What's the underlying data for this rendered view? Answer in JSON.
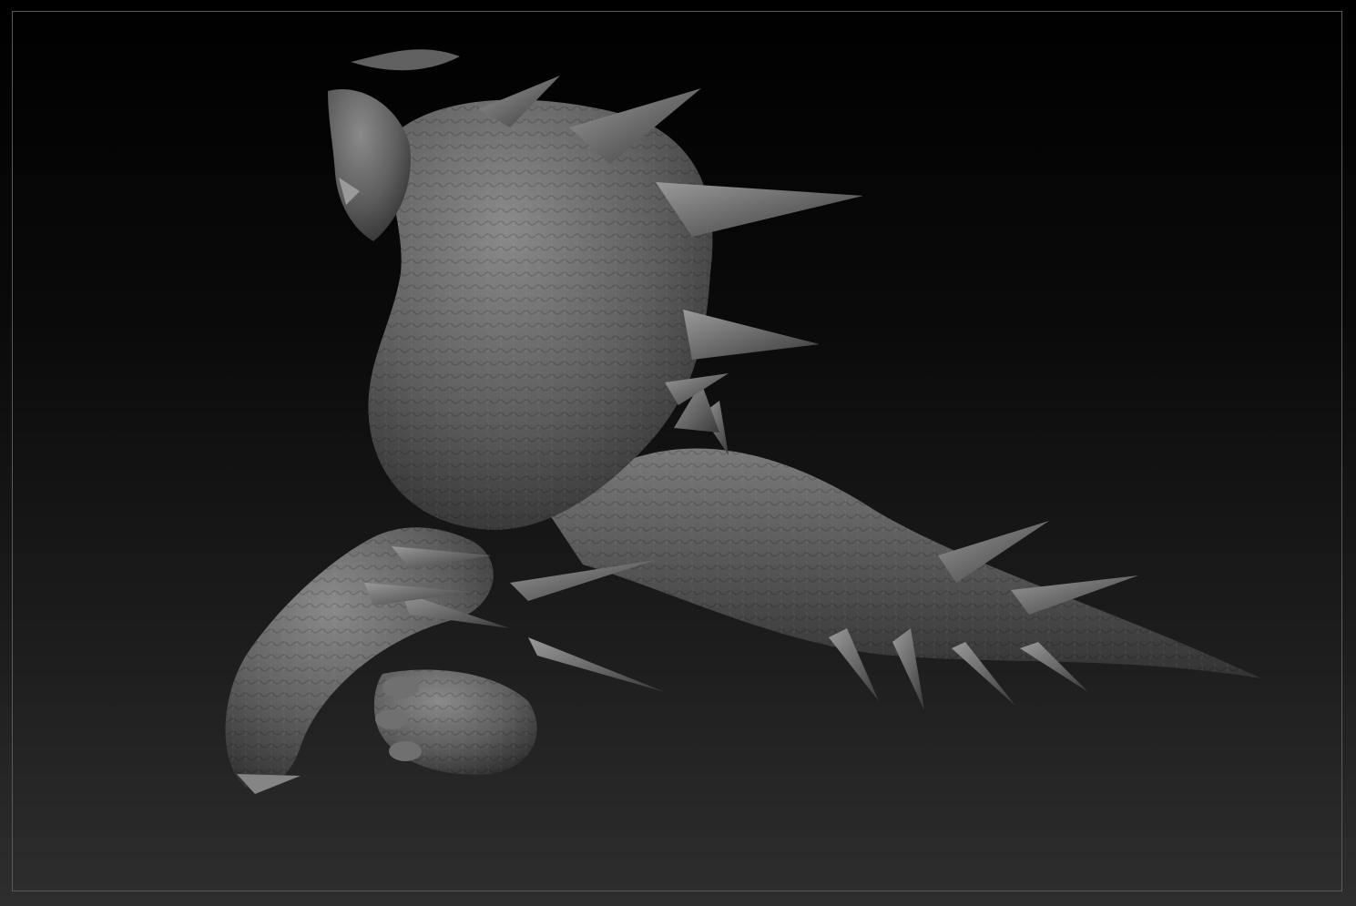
{
  "viewport": {
    "background_top": "#000000",
    "background_bottom": "#2e2e2e",
    "frame_color": "#5a5a5a"
  },
  "model": {
    "material_color": "#6e6e6e",
    "highlight_color": "#a6a6a6",
    "shadow_color": "#2a2a2a"
  }
}
